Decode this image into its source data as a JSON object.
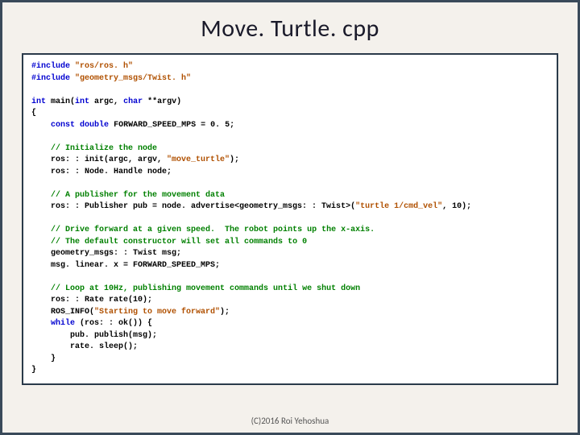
{
  "title": "Move. Turtle. cpp",
  "footer": "(C)2016 Roi Yehoshua",
  "code": {
    "l1a": "#include",
    "l1b": "\"ros/ros. h\"",
    "l2a": "#include",
    "l2b": "\"geometry_msgs/Twist. h\"",
    "l3a": "int",
    "l3b": " main(",
    "l3c": "int",
    "l3d": " argc, ",
    "l3e": "char",
    "l3f": " **argv)",
    "l4": "{",
    "l5a": "    ",
    "l5b": "const",
    "l5c": " ",
    "l5d": "double",
    "l5e": " FORWARD_SPEED_MPS = 0. 5;",
    "l6a": "    ",
    "l6b": "// Initialize the node",
    "l7a": "    ros: : init(argc, argv, ",
    "l7b": "\"move_turtle\"",
    "l7c": ");",
    "l8": "    ros: : Node. Handle node;",
    "l9a": "    ",
    "l9b": "// A publisher for the movement data",
    "l10a": "    ros: : Publisher pub = node. advertise<geometry_msgs: : Twist>(",
    "l10b": "\"turtle 1/cmd_vel\"",
    "l10c": ", 10);",
    "l11a": "    ",
    "l11b": "// Drive forward at a given speed.  The robot points up the x-axis.",
    "l12a": "    ",
    "l12b": "// The default constructor will set all commands to 0",
    "l13": "    geometry_msgs: : Twist msg;",
    "l14": "    msg. linear. x = FORWARD_SPEED_MPS;",
    "l15a": "    ",
    "l15b": "// Loop at 10Hz, publishing movement commands until we shut down",
    "l16": "    ros: : Rate rate(10);",
    "l17a": "    ROS_INFO(",
    "l17b": "\"Starting to move forward\"",
    "l17c": ");",
    "l18a": "    ",
    "l18b": "while",
    "l18c": " (ros: : ok()) {",
    "l19": "        pub. publish(msg);",
    "l20": "        rate. sleep();",
    "l21": "    }",
    "l22": "}"
  }
}
